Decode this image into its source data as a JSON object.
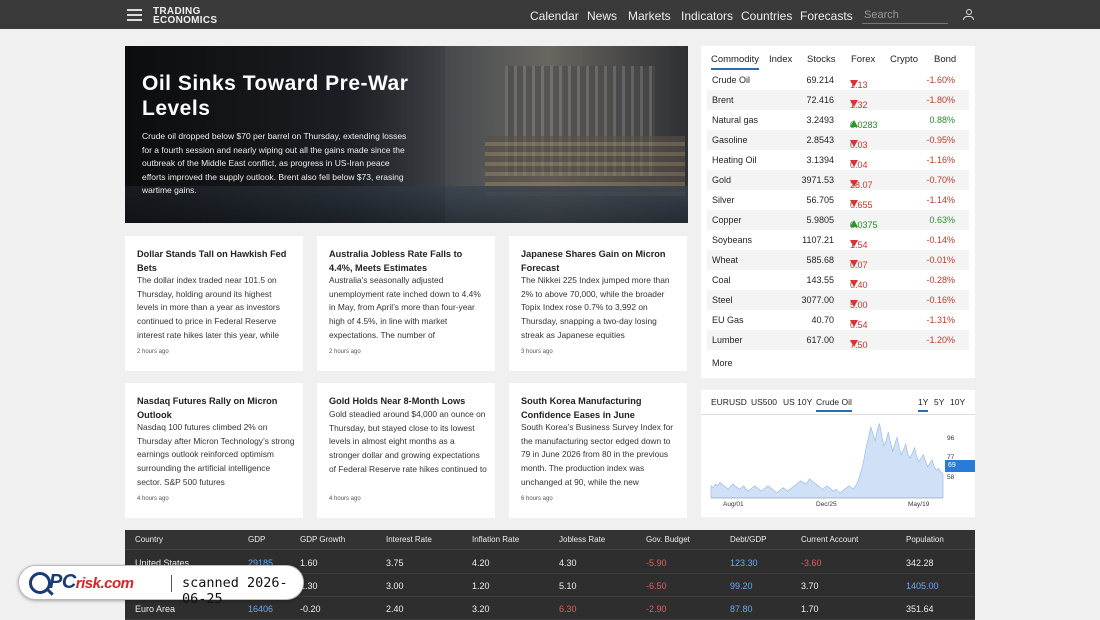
{
  "header": {
    "logo_line1": "TRADING",
    "logo_line2": "ECONOMICS",
    "nav": [
      "Calendar",
      "News",
      "Markets",
      "Indicators",
      "Countries",
      "Forecasts"
    ],
    "search_placeholder": "Search"
  },
  "hero": {
    "title": "Oil Sinks Toward Pre-War Levels",
    "body": "Crude oil dropped below $70 per barrel on Thursday, extending losses for a fourth session and nearly wiping out all the gains made since the outbreak of the Middle East conflict, as progress in US-Iran peace efforts improved the supply outlook. Brent also fell below $73, erasing wartime gains."
  },
  "cards": [
    {
      "title": "Dollar Stands Tall on Hawkish Fed Bets",
      "body": "The dollar index traded near 101.5 on Thursday, holding around its highest levels in more than a year as investors continued to price in Federal Reserve interest rate hikes later this year, while",
      "ago": "2 hours ago"
    },
    {
      "title": "Australia Jobless Rate Falls to 4.4%, Meets Estimates",
      "body": "Australia’s seasonally adjusted unemployment rate inched down to 4.4% in May, from April’s more than four-year high of 4.5%, in line with market expectations. The number of",
      "ago": "2 hours ago"
    },
    {
      "title": "Japanese Shares Gain on Micron Forecast",
      "body": "The Nikkei 225 Index jumped more than 2% to above 70,000, while the broader Topix Index rose 0.7% to 3,992 on Thursday, snapping a two-day losing streak as Japanese equities",
      "ago": "3 hours ago"
    },
    {
      "title": "Nasdaq Futures Rally on Micron Outlook",
      "body": "Nasdaq 100 futures climbed 2% on Thursday after Micron Technology’s strong earnings outlook reinforced optimism surrounding the artificial intelligence sector. S&P 500 futures",
      "ago": "4 hours ago"
    },
    {
      "title": "Gold Holds Near 8-Month Lows",
      "body": "Gold steadied around $4,000 an ounce on Thursday, but stayed close to its lowest levels in almost eight months as a stronger dollar and growing expectations of Federal Reserve rate hikes continued to weigh on prices.",
      "ago": "4 hours ago"
    },
    {
      "title": "South Korea Manufacturing Confidence Eases in June",
      "body": "South Korea’s Business Survey Index for the manufacturing sector edged down to 79 in June 2026 from 80 in the previous month. The production index was unchanged at 90, while the new",
      "ago": "6 hours ago"
    }
  ],
  "commodities": {
    "tabs": [
      "Commodity",
      "Index",
      "Stocks",
      "Forex",
      "Crypto",
      "Bond"
    ],
    "rows": [
      {
        "name": "Crude Oil",
        "price": "69.214",
        "change": "1.13",
        "pct": "-1.60%",
        "dir": "dn"
      },
      {
        "name": "Brent",
        "price": "72.416",
        "change": "1.32",
        "pct": "-1.80%",
        "dir": "dn"
      },
      {
        "name": "Natural gas",
        "price": "3.2493",
        "change": "0.0283",
        "pct": "0.88%",
        "dir": "up"
      },
      {
        "name": "Gasoline",
        "price": "2.8543",
        "change": "0.03",
        "pct": "-0.95%",
        "dir": "dn"
      },
      {
        "name": "Heating Oil",
        "price": "3.1394",
        "change": "0.04",
        "pct": "-1.16%",
        "dir": "dn"
      },
      {
        "name": "Gold",
        "price": "3971.53",
        "change": "28.07",
        "pct": "-0.70%",
        "dir": "dn"
      },
      {
        "name": "Silver",
        "price": "56.705",
        "change": "0.655",
        "pct": "-1.14%",
        "dir": "dn"
      },
      {
        "name": "Copper",
        "price": "5.9805",
        "change": "0.0375",
        "pct": "0.63%",
        "dir": "up"
      },
      {
        "name": "Soybeans",
        "price": "1107.21",
        "change": "1.54",
        "pct": "-0.14%",
        "dir": "dn"
      },
      {
        "name": "Wheat",
        "price": "585.68",
        "change": "0.07",
        "pct": "-0.01%",
        "dir": "dn"
      },
      {
        "name": "Coal",
        "price": "143.55",
        "change": "0.40",
        "pct": "-0.28%",
        "dir": "dn"
      },
      {
        "name": "Steel",
        "price": "3077.00",
        "change": "5.00",
        "pct": "-0.16%",
        "dir": "dn"
      },
      {
        "name": "EU Gas",
        "price": "40.70",
        "change": "0.54",
        "pct": "-1.31%",
        "dir": "dn"
      },
      {
        "name": "Lumber",
        "price": "617.00",
        "change": "7.50",
        "pct": "-1.20%",
        "dir": "dn"
      }
    ],
    "more": "More",
    "colors": {
      "up": "#2a8a2a",
      "down": "#c0392b"
    }
  },
  "minichart": {
    "tabs": [
      "EURUSD",
      "US500",
      "US 10Y",
      "Crude Oil"
    ],
    "active_tab": "Crude Oil",
    "ranges": [
      "1Y",
      "5Y",
      "10Y"
    ],
    "active_range": "1Y",
    "y_ticks": [
      "96",
      "77",
      "58"
    ],
    "current": "69",
    "x_ticks": [
      "Aug/01",
      "Dec/25",
      "May/19"
    ],
    "series": [
      62,
      61,
      63,
      62,
      64,
      63,
      62,
      61,
      60,
      62,
      63,
      62,
      61,
      60,
      61,
      62,
      60,
      59,
      60,
      61,
      62,
      61,
      60,
      59,
      60,
      61,
      62,
      61,
      60,
      59,
      58,
      59,
      60,
      61,
      60,
      59,
      60,
      61,
      62,
      63,
      64,
      65,
      64,
      63,
      64,
      66,
      65,
      64,
      63,
      62,
      61,
      60,
      61,
      62,
      61,
      60,
      59,
      60,
      59,
      58,
      59,
      60,
      61,
      62,
      61,
      60,
      62,
      64,
      68,
      72,
      78,
      85,
      90,
      96,
      92,
      88,
      94,
      98,
      91,
      85,
      88,
      93,
      87,
      82,
      86,
      90,
      84,
      80,
      83,
      86,
      80,
      78,
      81,
      84,
      79,
      76,
      78,
      80,
      76,
      73,
      75,
      77,
      73,
      71,
      72,
      70,
      69
    ],
    "ylim": [
      55,
      100
    ]
  },
  "indicators": {
    "headers": [
      "Country",
      "GDP",
      "GDP Growth",
      "Interest Rate",
      "Inflation Rate",
      "Jobless Rate",
      "Gov. Budget",
      "Debt/GDP",
      "Current Account",
      "Population"
    ],
    "rows": [
      [
        "United States",
        "29185",
        "1.60",
        "3.75",
        "4.20",
        "4.30",
        "-5.90",
        "123.30",
        "-3.60",
        "342.28"
      ],
      [
        "",
        "",
        "1.30",
        "3.00",
        "1.20",
        "5.10",
        "-6.50",
        "99.20",
        "3.70",
        "1405.00"
      ],
      [
        "Euro Area",
        "16406",
        "-0.20",
        "2.40",
        "3.20",
        "6.30",
        "-2.90",
        "87.80",
        "1.70",
        "351.64"
      ]
    ]
  },
  "badge": {
    "brand_pc": "PC",
    "brand_risk": "risk",
    "brand_com": ".com",
    "scan_text": "scanned 2026-06-25"
  }
}
